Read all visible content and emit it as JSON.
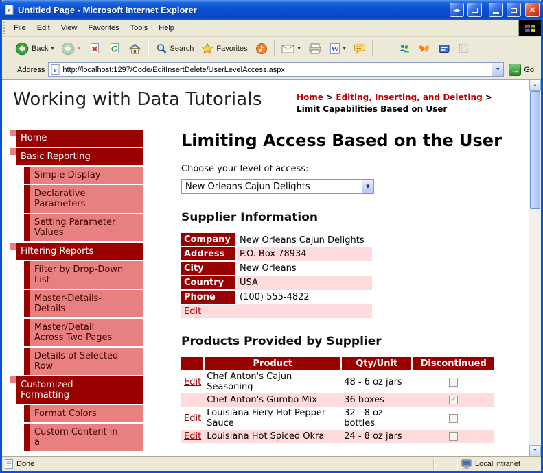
{
  "window": {
    "title": "Untitled Page - Microsoft Internet Explorer",
    "status": {
      "left": "Done",
      "right": "Local intranet"
    }
  },
  "menubar": {
    "items": [
      "File",
      "Edit",
      "View",
      "Favorites",
      "Tools",
      "Help"
    ]
  },
  "toolbar": {
    "back_label": "Back",
    "search_label": "Search",
    "favorites_label": "Favorites"
  },
  "address": {
    "label": "Address",
    "url": "http://localhost:1297/Code/EditInsertDelete/UserLevelAccess.aspx",
    "go": "Go"
  },
  "header": {
    "site_title": "Working with Data Tutorials",
    "breadcrumb": {
      "home": "Home",
      "sep1": ">",
      "section": "Editing, Inserting, and Deleting",
      "sep2": ">",
      "current": "Limit Capabilities Based on User"
    }
  },
  "sidebar": {
    "items": [
      {
        "label": "Home",
        "level": 1
      },
      {
        "label": "Basic Reporting",
        "level": 1
      },
      {
        "label": "Simple Display",
        "level": 2
      },
      {
        "label": "Declarative Parameters",
        "level": 2
      },
      {
        "label": "Setting Parameter Values",
        "level": 2
      },
      {
        "label": "Filtering Reports",
        "level": 1
      },
      {
        "label": "Filter by Drop-Down List",
        "level": 2
      },
      {
        "label": "Master-Details-Details",
        "level": 2
      },
      {
        "label": "Master/Detail Across Two Pages",
        "level": 2
      },
      {
        "label": "Details of Selected Row",
        "level": 2
      },
      {
        "label": "Customized Formatting",
        "level": 1
      },
      {
        "label": "Format Colors",
        "level": 2
      },
      {
        "label": "Custom Content in a",
        "level": 2
      }
    ]
  },
  "main": {
    "title": "Limiting Access Based on the User",
    "access_prompt": "Choose your level of access:",
    "access_selected": "New Orleans Cajun Delights",
    "supplier_heading": "Supplier Information",
    "supplier": {
      "fields": [
        {
          "label": "Company",
          "value": "New Orleans Cajun Delights"
        },
        {
          "label": "Address",
          "value": "P.O. Box 78934"
        },
        {
          "label": "City",
          "value": "New Orleans"
        },
        {
          "label": "Country",
          "value": "USA"
        },
        {
          "label": "Phone",
          "value": "(100) 555-4822"
        }
      ],
      "edit": "Edit"
    },
    "products_heading": "Products Provided by Supplier",
    "products": {
      "headers": [
        "Product",
        "Qty/Unit",
        "Discontinued"
      ],
      "rows": [
        {
          "edit": "Edit",
          "product": "Chef Anton's Cajun Seasoning",
          "qty": "48 - 6 oz jars",
          "discontinued": false
        },
        {
          "edit": "",
          "product": "Chef Anton's Gumbo Mix",
          "qty": "36 boxes",
          "discontinued": true
        },
        {
          "edit": "Edit",
          "product": "Louisiana Fiery Hot Pepper Sauce",
          "qty": "32 - 8 oz bottles",
          "discontinued": false
        },
        {
          "edit": "Edit",
          "product": "Louisiana Hot Spiced Okra",
          "qty": "24 - 8 oz jars",
          "discontinued": false
        }
      ]
    }
  },
  "icons": {
    "title_icon": "ie-page-icon",
    "back": "green-circle-left-arrow",
    "forward": "faded-circle-right-arrow",
    "stop": "page-with-red-x",
    "refresh": "page-with-green-arrows",
    "home": "house",
    "search": "magnifier",
    "favorites": "yellow-star",
    "media": "orange-circle-note",
    "mail": "envelope",
    "print": "printer",
    "edit_word": "page-with-blue-w",
    "discuss": "yellow-chat-bubble",
    "go": "green-arrow",
    "windows_logo": "windows-flag",
    "done": "page",
    "local_intranet": "monitor"
  },
  "colors": {
    "titlebar_blue": "#0a50d0",
    "chrome_beige": "#ece9d8",
    "maroon": "#990000",
    "salmon": "#e88080",
    "row_pink": "#ffdbdb",
    "link_red": "#c00000",
    "close_red": "#c23010"
  }
}
